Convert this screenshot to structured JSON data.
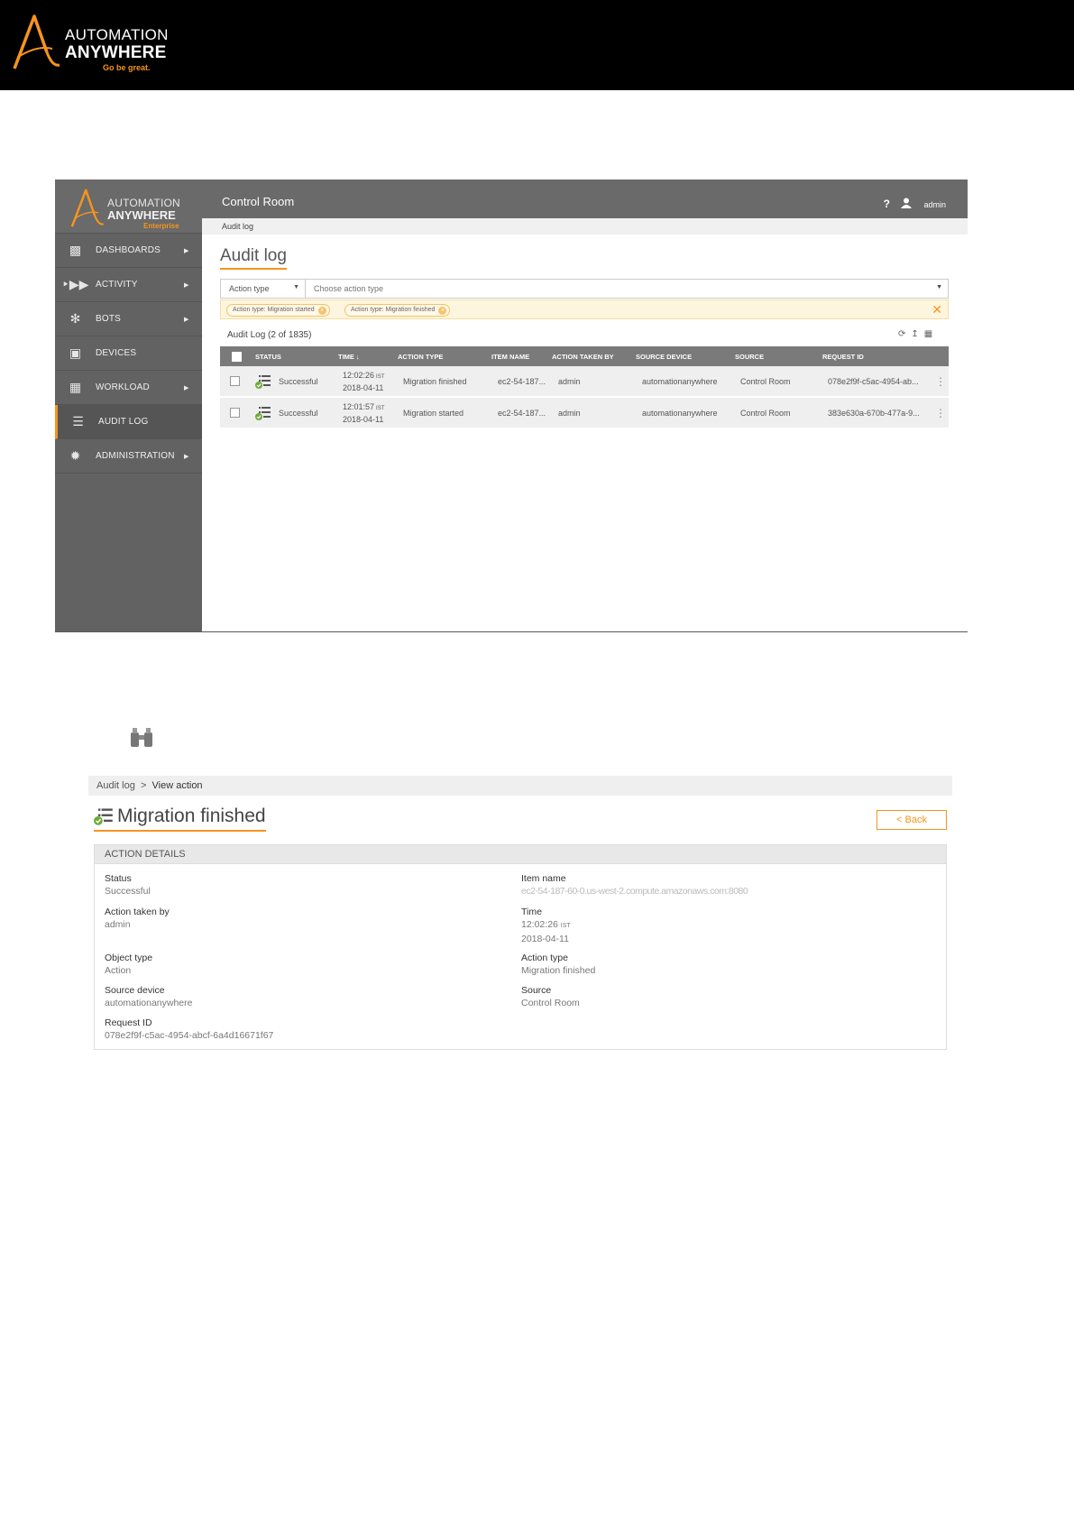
{
  "banner": {
    "logo": {
      "line1": "AUTOMATION",
      "line2": "ANYWHERE",
      "tagline": "Go be great."
    }
  },
  "control_room": {
    "sidebar_logo": {
      "line1": "AUTOMATION",
      "line2": "ANYWHERE",
      "edition": "Enterprise"
    },
    "nav": [
      {
        "label": "DASHBOARDS",
        "icon": "dashboard-icon",
        "caret": true
      },
      {
        "label": "ACTIVITY",
        "icon": "activity-icon",
        "caret": true
      },
      {
        "label": "BOTS",
        "icon": "bots-icon",
        "caret": true
      },
      {
        "label": "DEVICES",
        "icon": "devices-icon",
        "caret": false
      },
      {
        "label": "WORKLOAD",
        "icon": "workload-icon",
        "caret": true
      },
      {
        "label": "AUDIT LOG",
        "icon": "list-icon",
        "caret": false,
        "active": true
      },
      {
        "label": "ADMINISTRATION",
        "icon": "gear-icon",
        "caret": true
      }
    ],
    "topbar": {
      "title": "Control Room",
      "help": "?",
      "user": "admin"
    },
    "breadcrumb": "Audit log",
    "page_title": "Audit log",
    "filter": {
      "type_label": "Action type",
      "placeholder": "Choose action type"
    },
    "chips": [
      "Action type: Migration started",
      "Action type: Migration finished"
    ],
    "log_count": "Audit Log (2 of 1835)",
    "grid": {
      "columns": [
        "STATUS",
        "TIME ↓",
        "ACTION TYPE",
        "ITEM NAME",
        "ACTION TAKEN BY",
        "SOURCE DEVICE",
        "SOURCE",
        "REQUEST ID"
      ],
      "rows": [
        {
          "status": "Successful",
          "time": "12:02:26",
          "tz": "IST",
          "date": "2018-04-11",
          "action_type": "Migration finished",
          "item_name": "ec2-54-187...",
          "taken_by": "admin",
          "source_device": "automationanywhere",
          "source": "Control Room",
          "request_id": "078e2f9f-c5ac-4954-ab..."
        },
        {
          "status": "Successful",
          "time": "12:01:57",
          "tz": "IST",
          "date": "2018-04-11",
          "action_type": "Migration started",
          "item_name": "ec2-54-187...",
          "taken_by": "admin",
          "source_device": "automationanywhere",
          "source": "Control Room",
          "request_id": "383e630a-670b-477a-9..."
        }
      ]
    }
  },
  "view_action": {
    "breadcrumb": {
      "parent": "Audit log",
      "sep": ">",
      "current": "View action"
    },
    "title": "Migration finished",
    "back_label": "< Back",
    "section_title": "ACTION DETAILS",
    "fields": {
      "status": {
        "label": "Status",
        "value": "Successful"
      },
      "item_name": {
        "label": "Item name",
        "value": "ec2-54-187-60-0.us-west-2.compute.amazonaws.com:8080"
      },
      "action_taken_by": {
        "label": "Action taken by",
        "value": "admin"
      },
      "time": {
        "label": "Time",
        "value": "12:02:26",
        "tz": "IST",
        "date": "2018-04-11"
      },
      "object_type": {
        "label": "Object type",
        "value": "Action"
      },
      "action_type": {
        "label": "Action type",
        "value": "Migration finished"
      },
      "source_device": {
        "label": "Source device",
        "value": "automationanywhere"
      },
      "source": {
        "label": "Source",
        "value": "Control Room"
      },
      "request_id": {
        "label": "Request ID",
        "value": "078e2f9f-c5ac-4954-abcf-6a4d16671f67"
      }
    }
  },
  "colors": {
    "accent": "#f7941e",
    "sidebar": "#626262",
    "topbar": "#6a6a6a",
    "grid_header": "#7a7a7a",
    "success": "#6cab3a"
  }
}
